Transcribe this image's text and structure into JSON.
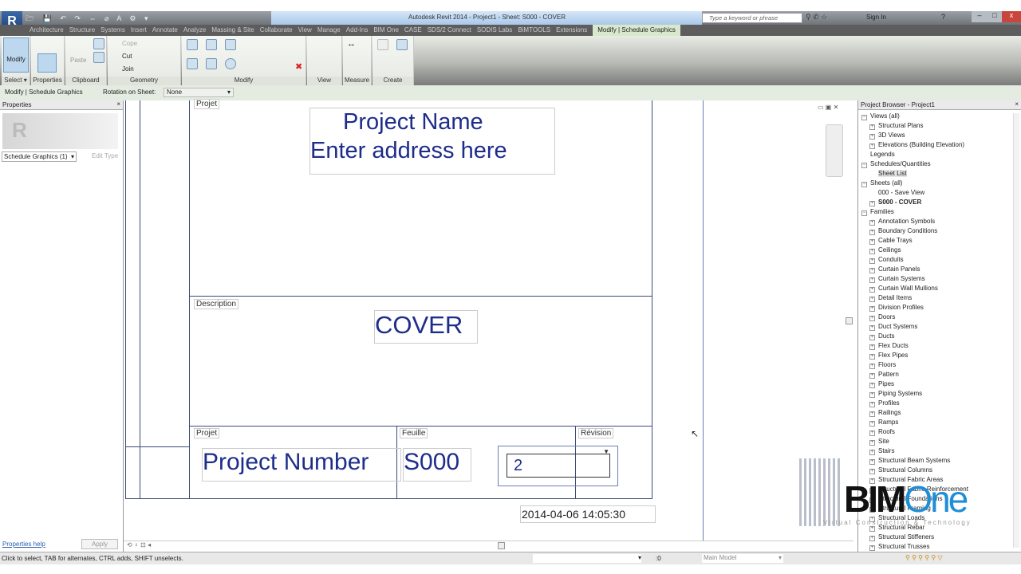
{
  "app": {
    "title": "Autodesk Revit 2014 -    Project1 - Sheet: S000 - COVER",
    "search_placeholder": "Type a keyword or phrase",
    "sign_in": "Sign In"
  },
  "tabs": [
    "Architecture",
    "Structure",
    "Systems",
    "Insert",
    "Annotate",
    "Analyze",
    "Massing & Site",
    "Collaborate",
    "View",
    "Manage",
    "Add-Ins",
    "BIM One",
    "CASE",
    "SDS/2 Connect",
    "SODIS Labs",
    "BiMTOOLS",
    "Extensions",
    "Modify | Schedule Graphics"
  ],
  "ribbon": {
    "modify": "Modify",
    "select": "Select ▾",
    "properties": "Properties",
    "clipboard": "Clipboard",
    "paste": "Paste",
    "geometry": "Geometry",
    "cope": "Cope",
    "cut": "Cut",
    "join": "Join",
    "modify_panel": "Modify",
    "view": "View",
    "measure": "Measure",
    "create": "Create"
  },
  "options_bar": {
    "context": "Modify | Schedule Graphics",
    "rotation_label": "Rotation on Sheet:",
    "rotation_value": "None"
  },
  "properties": {
    "title": "Properties",
    "type_selector": "Schedule Graphics (1)",
    "edit_type": "Edit Type",
    "help": "Properties help",
    "apply": "Apply"
  },
  "sheet": {
    "projet_top": "Projet",
    "project_name": "Project Name",
    "address": "Enter address here",
    "description_label": "Description",
    "description": "COVER",
    "projet_label": "Projet",
    "project_number": "Project Number",
    "feuille_label": "Feuille",
    "sheet_number": "S000",
    "revision_label": "Révision",
    "revision": "2",
    "timestamp": "2014-04-06 14:05:30"
  },
  "browser": {
    "title": "Project Browser - Project1",
    "items": [
      {
        "label": "Views (all)",
        "level": 0,
        "exp": "-"
      },
      {
        "label": "Structural Plans",
        "level": 1,
        "exp": "+"
      },
      {
        "label": "3D Views",
        "level": 1,
        "exp": "+"
      },
      {
        "label": "Elevations (Building Elevation)",
        "level": 1,
        "exp": "+"
      },
      {
        "label": "Legends",
        "level": 0,
        "exp": ""
      },
      {
        "label": "Schedules/Quantities",
        "level": 0,
        "exp": "-"
      },
      {
        "label": "Sheet List",
        "level": 1,
        "exp": "",
        "selected": true
      },
      {
        "label": "Sheets (all)",
        "level": 0,
        "exp": "-"
      },
      {
        "label": "000 - Save View",
        "level": 1,
        "exp": ""
      },
      {
        "label": "S000 - COVER",
        "level": 1,
        "exp": "+",
        "bold": true
      },
      {
        "label": "Families",
        "level": 0,
        "exp": "-"
      },
      {
        "label": "Annotation Symbols",
        "level": 1,
        "exp": "+"
      },
      {
        "label": "Boundary Conditions",
        "level": 1,
        "exp": "+"
      },
      {
        "label": "Cable Trays",
        "level": 1,
        "exp": "+"
      },
      {
        "label": "Ceilings",
        "level": 1,
        "exp": "+"
      },
      {
        "label": "Conduits",
        "level": 1,
        "exp": "+"
      },
      {
        "label": "Curtain Panels",
        "level": 1,
        "exp": "+"
      },
      {
        "label": "Curtain Systems",
        "level": 1,
        "exp": "+"
      },
      {
        "label": "Curtain Wall Mullions",
        "level": 1,
        "exp": "+"
      },
      {
        "label": "Detail Items",
        "level": 1,
        "exp": "+"
      },
      {
        "label": "Division Profiles",
        "level": 1,
        "exp": "+"
      },
      {
        "label": "Doors",
        "level": 1,
        "exp": "+"
      },
      {
        "label": "Duct Systems",
        "level": 1,
        "exp": "+"
      },
      {
        "label": "Ducts",
        "level": 1,
        "exp": "+"
      },
      {
        "label": "Flex Ducts",
        "level": 1,
        "exp": "+"
      },
      {
        "label": "Flex Pipes",
        "level": 1,
        "exp": "+"
      },
      {
        "label": "Floors",
        "level": 1,
        "exp": "+"
      },
      {
        "label": "Pattern",
        "level": 1,
        "exp": "+"
      },
      {
        "label": "Pipes",
        "level": 1,
        "exp": "+"
      },
      {
        "label": "Piping Systems",
        "level": 1,
        "exp": "+"
      },
      {
        "label": "Profiles",
        "level": 1,
        "exp": "+"
      },
      {
        "label": "Railings",
        "level": 1,
        "exp": "+"
      },
      {
        "label": "Ramps",
        "level": 1,
        "exp": "+"
      },
      {
        "label": "Roofs",
        "level": 1,
        "exp": "+"
      },
      {
        "label": "Site",
        "level": 1,
        "exp": "+"
      },
      {
        "label": "Stairs",
        "level": 1,
        "exp": "+"
      },
      {
        "label": "Structural Beam Systems",
        "level": 1,
        "exp": "+"
      },
      {
        "label": "Structural Columns",
        "level": 1,
        "exp": "+"
      },
      {
        "label": "Structural Fabric Areas",
        "level": 1,
        "exp": "+"
      },
      {
        "label": "Structural Fabric Reinforcement",
        "level": 1,
        "exp": "+"
      },
      {
        "label": "Structural Foundations",
        "level": 1,
        "exp": "+"
      },
      {
        "label": "Structural Framing",
        "level": 1,
        "exp": "+"
      },
      {
        "label": "Structural Loads",
        "level": 1,
        "exp": "+"
      },
      {
        "label": "Structural Rebar",
        "level": 1,
        "exp": "+"
      },
      {
        "label": "Structural Stiffeners",
        "level": 1,
        "exp": "+"
      },
      {
        "label": "Structural Trusses",
        "level": 1,
        "exp": "+"
      }
    ]
  },
  "watermark": {
    "brand": "BIMOne",
    "tagline": "Virtual Construction & Technology"
  },
  "status": {
    "hint": "Click to select, TAB for alternates, CTRL adds, SHIFT unselects.",
    "model": "Main Model",
    "count": ":0"
  }
}
